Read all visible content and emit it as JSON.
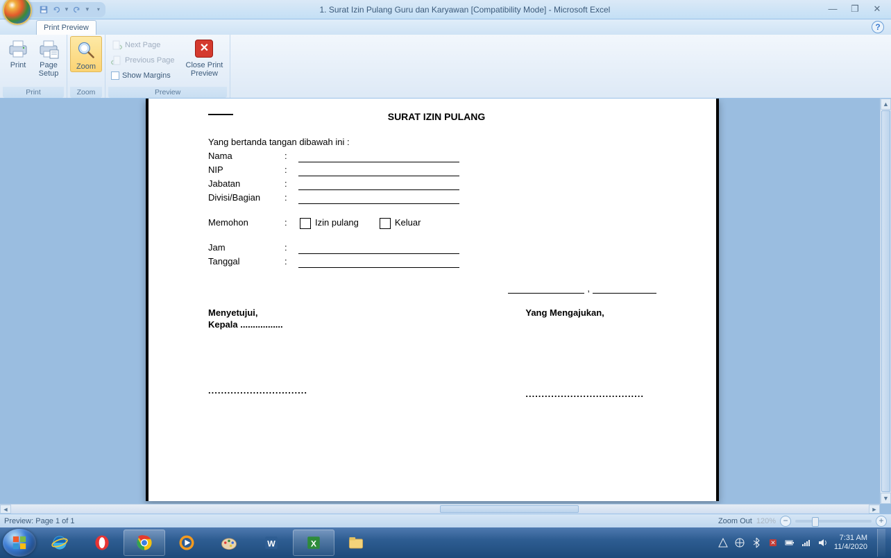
{
  "titlebar": {
    "title": "1. Surat Izin Pulang Guru dan Karyawan  [Compatibility Mode] - Microsoft Excel"
  },
  "tabs": {
    "active": "Print Preview"
  },
  "ribbon": {
    "print": {
      "print_label": "Print",
      "setup_label": "Page\nSetup",
      "group_label": "Print"
    },
    "zoom": {
      "zoom_label": "Zoom",
      "group_label": "Zoom"
    },
    "preview": {
      "next": "Next Page",
      "prev": "Previous Page",
      "margins": "Show Margins",
      "close_label": "Close Print\nPreview",
      "group_label": "Preview"
    }
  },
  "document": {
    "title": "SURAT IZIN PULANG",
    "intro": "Yang bertanda tangan dibawah ini :",
    "fields": {
      "nama": "Nama",
      "nip": "NIP",
      "jabatan": "Jabatan",
      "divisi": "Divisi/Bagian",
      "memohon": "Memohon",
      "opt_izin": "Izin pulang",
      "opt_keluar": "Keluar",
      "jam": "Jam",
      "tanggal": "Tanggal"
    },
    "sig": {
      "approve_title": "Menyetujui,",
      "approve_sub": "Kepala .................",
      "approve_dots": "...............................",
      "request_title": "Yang Mengajukan,",
      "request_dots": "....................................."
    }
  },
  "statusbar": {
    "left": "Preview: Page 1 of 1",
    "zoom_label": "Zoom Out",
    "zoom_val": "120%"
  },
  "taskbar": {
    "time": "7:31 AM",
    "date": "11/4/2020"
  }
}
